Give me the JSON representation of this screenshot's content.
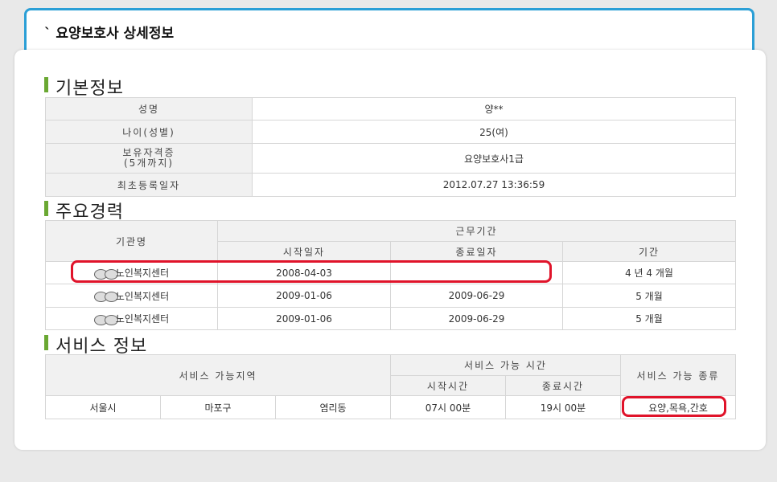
{
  "page": {
    "title": "` 요양보호사 상세정보"
  },
  "basic_info": {
    "section_title": "기본정보",
    "rows": [
      {
        "label": "성명",
        "value": "양**"
      },
      {
        "label": "나이(성별)",
        "value": "25(여)"
      },
      {
        "label": "보유자격증\n(5개까지)",
        "value": "요양보호사1급"
      },
      {
        "label": "최초등록일자",
        "value": "2012.07.27 13:36:59"
      }
    ]
  },
  "career": {
    "section_title": "주요경력",
    "headers": {
      "org": "기관명",
      "work_period": "근무기간",
      "start": "시작일자",
      "end": "종료일자",
      "duration": "기간"
    },
    "rows": [
      {
        "org": "노인복지센터",
        "start": "2008-04-03",
        "end": "",
        "duration": "4 년 4 개월"
      },
      {
        "org": "노인복지센터",
        "start": "2009-01-06",
        "end": "2009-06-29",
        "duration": "5 개월"
      },
      {
        "org": "노인복지센터",
        "start": "2009-01-06",
        "end": "2009-06-29",
        "duration": "5 개월"
      }
    ]
  },
  "service": {
    "section_title": "서비스 정보",
    "headers": {
      "area": "서비스 가능지역",
      "time": "서비스 가능 시간",
      "start_time": "시작시간",
      "end_time": "종료시간",
      "type": "서비스 가능 종류"
    },
    "row": {
      "city": "서울시",
      "district": "마포구",
      "dong": "염리동",
      "start_time": "07시 00분",
      "end_time": "19시 00분",
      "types": "요양,목욕,간호"
    }
  },
  "highlight_color": "#e0132a",
  "accent_color": "#6aa832",
  "header_border_color": "#2b9fd6"
}
